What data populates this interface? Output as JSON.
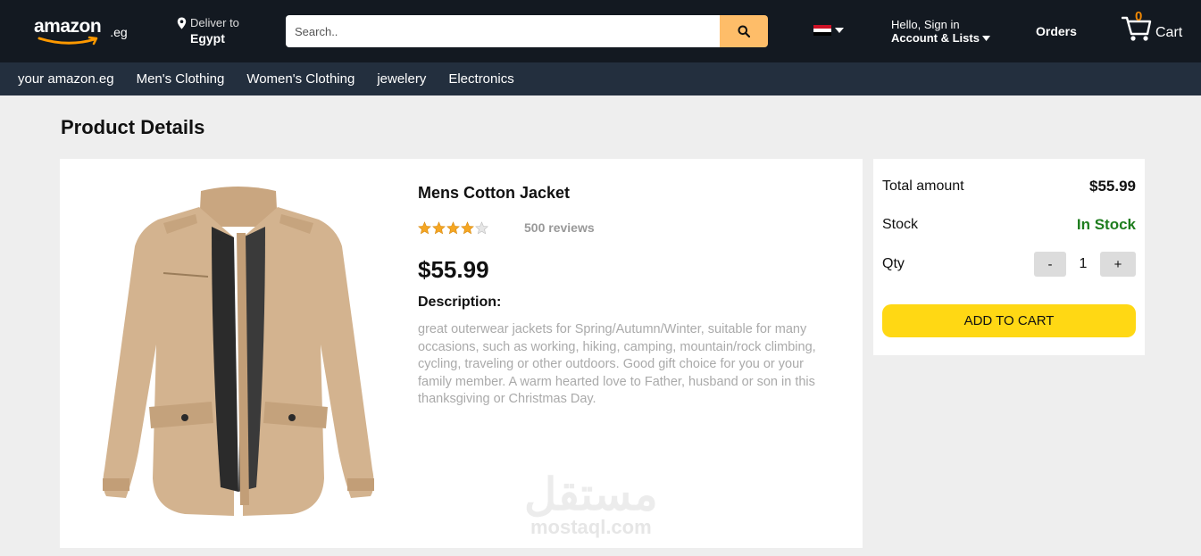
{
  "header": {
    "logo_text": "amazon",
    "logo_tld": ".eg",
    "deliver_label": "Deliver to",
    "deliver_country": "Egypt",
    "search_placeholder": "Search..",
    "account_greeting": "Hello, Sign in",
    "account_lists": "Account & Lists",
    "orders_label": "Orders",
    "cart_count": "0",
    "cart_label": "Cart"
  },
  "nav": {
    "items": [
      "your amazon.eg",
      "Men's Clothing",
      "Women's Clothing",
      "jewelery",
      "Electronics"
    ]
  },
  "page": {
    "title": "Product Details"
  },
  "product": {
    "name": "Mens Cotton Jacket",
    "rating": 4,
    "rating_max": 5,
    "reviews": "500 reviews",
    "price": "$55.99",
    "description_title": "Description:",
    "description": "great outerwear jackets for Spring/Autumn/Winter, suitable for many occasions, such as working, hiking, camping, mountain/rock climbing, cycling, traveling or other outdoors. Good gift choice for you or your family member. A warm hearted love to Father, husband or son in this thanksgiving or Christmas Day."
  },
  "summary": {
    "total_label": "Total amount",
    "total_value": "$55.99",
    "stock_label": "Stock",
    "stock_value": "In Stock",
    "qty_label": "Qty",
    "qty_minus": "-",
    "qty_value": "1",
    "qty_plus": "+",
    "add_to_cart": "ADD TO CART"
  },
  "watermark": {
    "arabic": "مستقل",
    "latin": "mostaql.com"
  },
  "colors": {
    "header_bg": "#131921",
    "nav_bg": "#232f3e",
    "search_button": "#febd69",
    "cart_count": "#f08804",
    "in_stock": "#1e7d1e",
    "add_to_cart_bg": "#ffd814",
    "jacket": "#d3b38f"
  },
  "icons": {
    "location": "location-pin-icon",
    "search": "search-icon",
    "flag": "egypt-flag-icon",
    "caret": "caret-down-icon",
    "cart": "cart-icon",
    "star": "star-icon"
  }
}
